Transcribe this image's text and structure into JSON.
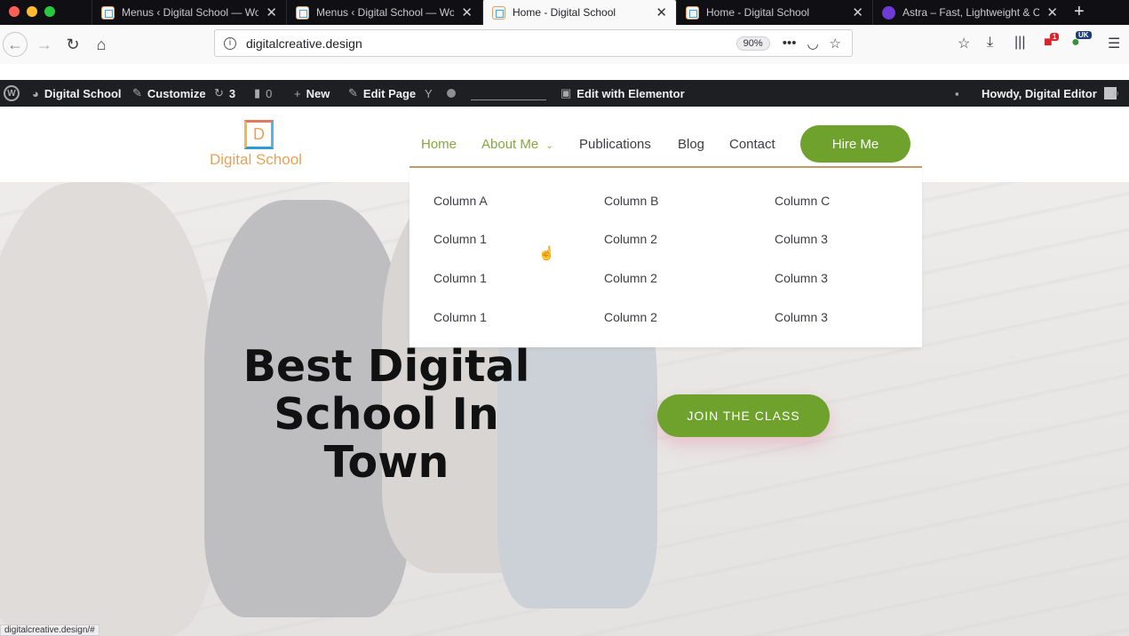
{
  "browser": {
    "tabs": [
      {
        "title": "Menus ‹ Digital School — Wor",
        "favicon": "digital-school-favicon"
      },
      {
        "title": "Menus ‹ Digital School — Wor",
        "favicon": "digital-school-favicon"
      },
      {
        "title": "Home - Digital School",
        "favicon": "digital-school-favicon",
        "active": true
      },
      {
        "title": "Home - Digital School",
        "favicon": "digital-school-favicon"
      },
      {
        "title": "Astra – Fast, Lightweight & Cu",
        "favicon": "astra-favicon"
      }
    ],
    "url": "digitalcreative.design",
    "zoom": "90%",
    "badges": {
      "red_addon": "1",
      "flag_addon": "UK"
    },
    "status_url": "digitalcreative.design/#"
  },
  "wp_admin_bar": {
    "site_name": "Digital School",
    "customize": "Customize",
    "updates_count": "3",
    "comments_count": "0",
    "new_label": "New",
    "edit_page": "Edit Page",
    "yoast": "Y",
    "elementor": "Edit with Elementor",
    "greeting": "Howdy, Digital Editor"
  },
  "site": {
    "logo_letter": "D",
    "logo_text": "Digital School",
    "nav": [
      "Home",
      "About Me",
      "Publications",
      "Blog",
      "Contact"
    ],
    "cta": "Hire Me",
    "mega_menu": {
      "columns": [
        {
          "heading": "Column A",
          "items": [
            "Column 1",
            "Column 1",
            "Column 1"
          ]
        },
        {
          "heading": "Column B",
          "items": [
            "Column 2",
            "Column 2",
            "Column 2"
          ]
        },
        {
          "heading": "Column C",
          "items": [
            "Column 3",
            "Column 3",
            "Column 3"
          ]
        }
      ]
    },
    "hero": {
      "headline": [
        "Best Digital",
        "School In",
        "Town"
      ],
      "button": "JOIN THE CLASS"
    }
  },
  "colors": {
    "accent_green": "#6ea22d",
    "active_nav": "#86a83a",
    "logo_orange": "#e9a255",
    "wp_bar": "#1e1f23"
  }
}
